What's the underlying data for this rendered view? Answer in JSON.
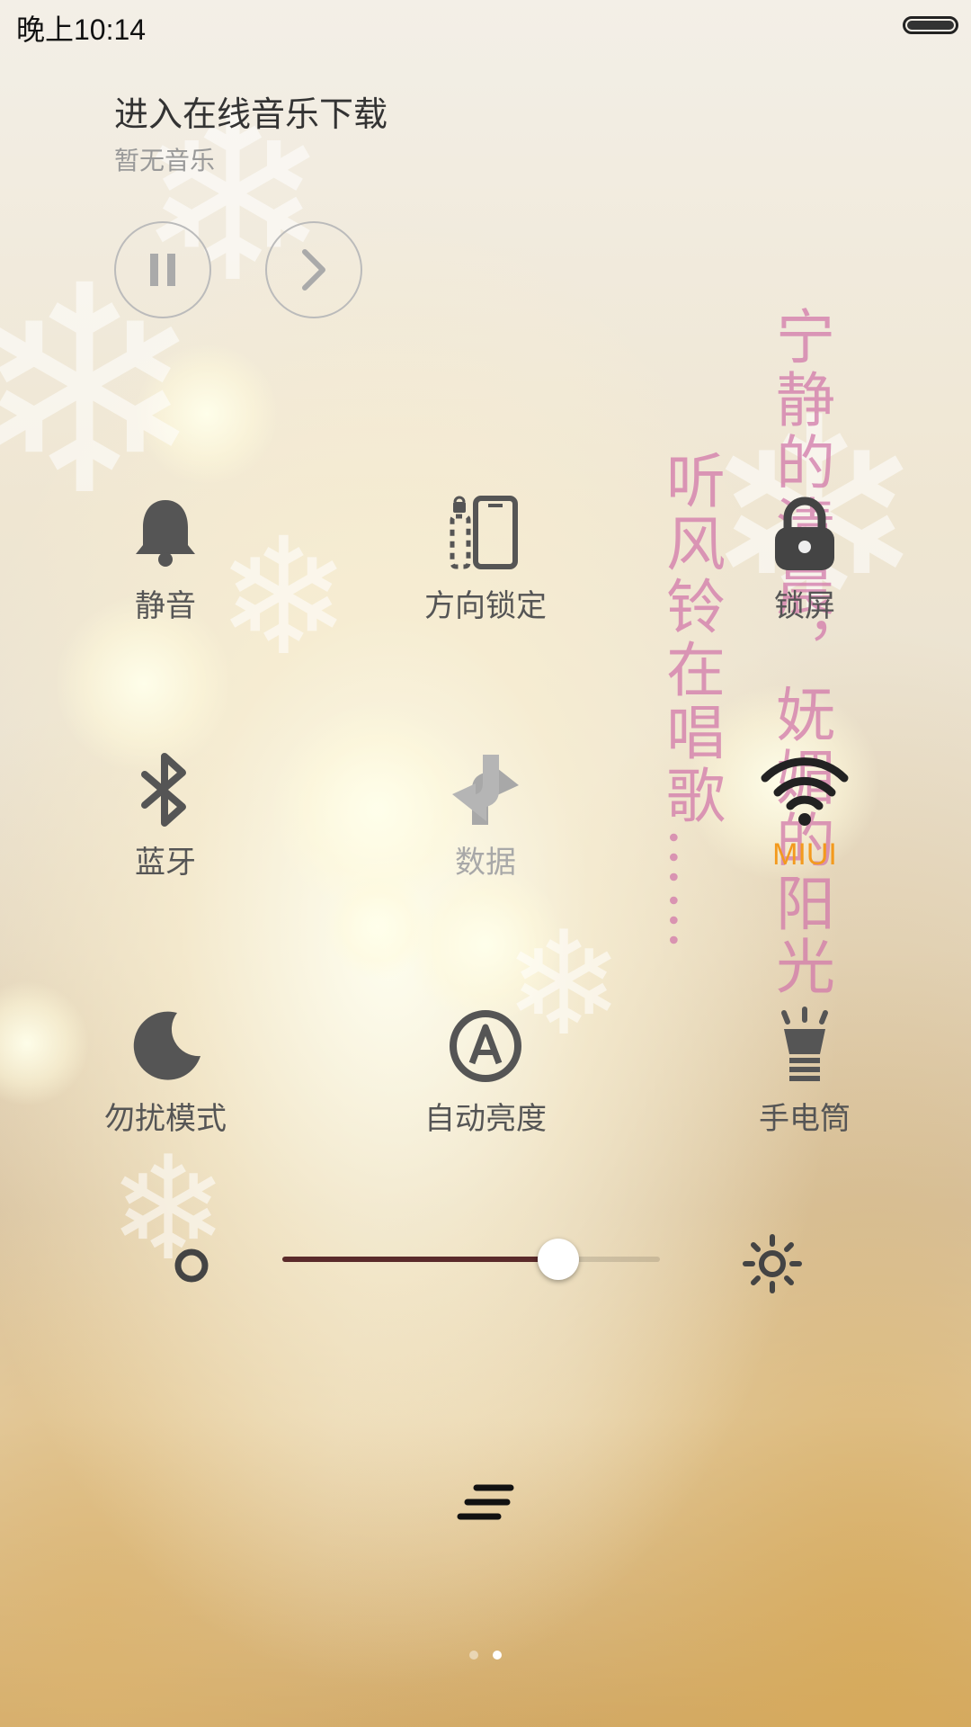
{
  "status_bar": {
    "time": "晚上10:14"
  },
  "music": {
    "title": "进入在线音乐下载",
    "subtitle": "暂无音乐",
    "controls": [
      "pause-icon",
      "next-icon"
    ]
  },
  "toggles": [
    {
      "id": "silent",
      "label": "静音",
      "icon": "bell-icon",
      "state": "off"
    },
    {
      "id": "rotation-lock",
      "label": "方向锁定",
      "icon": "rotation-lock-icon",
      "state": "off"
    },
    {
      "id": "lock-screen",
      "label": "锁屏",
      "icon": "lock-icon",
      "state": "off"
    },
    {
      "id": "bluetooth",
      "label": "蓝牙",
      "icon": "bluetooth-icon",
      "state": "off"
    },
    {
      "id": "data",
      "label": "数据",
      "icon": "data-icon",
      "state": "disabled"
    },
    {
      "id": "wifi",
      "label": "MIUI",
      "icon": "wifi-icon",
      "state": "on"
    },
    {
      "id": "dnd",
      "label": "勿扰模式",
      "icon": "moon-icon",
      "state": "off"
    },
    {
      "id": "auto-brightness",
      "label": "自动亮度",
      "icon": "auto-brightness-icon",
      "state": "off"
    },
    {
      "id": "flashlight",
      "label": "手电筒",
      "icon": "flashlight-icon",
      "state": "off"
    }
  ],
  "wallpaper_text": {
    "line1": "宁静的清晨，妩媚的阳光",
    "line2": "听风铃在唱歌……"
  },
  "brightness": {
    "level": 0.73,
    "min_icon": "brightness-low-icon",
    "max_icon": "brightness-high-icon"
  },
  "bottom": {
    "icon": "edit-list-icon"
  },
  "pager": {
    "count": 2,
    "active": 1
  },
  "colors": {
    "active": "#f39a1e",
    "icon": "#555555",
    "label": "#555555",
    "disabled": "#a8a8a8",
    "slider_fill": "#5a2a2a"
  }
}
